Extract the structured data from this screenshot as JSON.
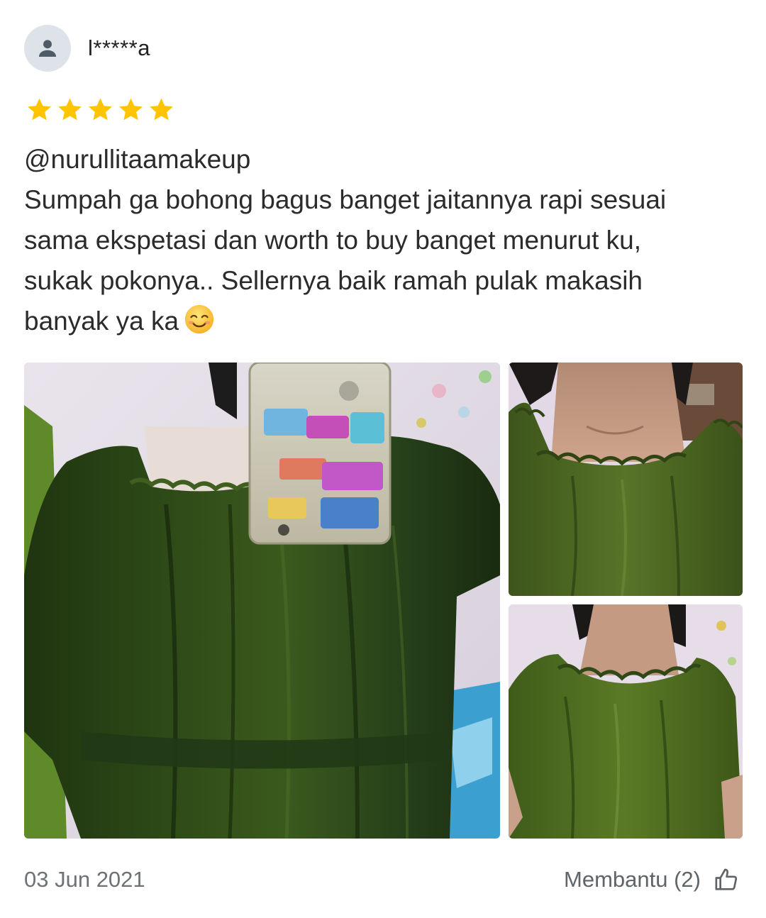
{
  "reviewer": {
    "name": "l*****a",
    "avatar_icon": "user-icon"
  },
  "rating": {
    "value": 5,
    "max": 5,
    "star_color": "#ffc400"
  },
  "review": {
    "text_line1": "@nurullitaamakeup",
    "text_line2": "Sumpah ga bohong bagus banget jaitannya rapi sesuai",
    "text_line3": "sama ekspetasi dan worth to buy banget menurut ku,",
    "text_line4": "sukak pokonya.. Sellernya baik ramah pulak makasih",
    "text_line5": "banyak ya ka",
    "emoji": "smiling-face-icon"
  },
  "photos": [
    {
      "subject": "mirror selfie wearing green satin off-shoulder top"
    },
    {
      "subject": "close-up of green ruffled neckline"
    },
    {
      "subject": "green satin top with elastic neckline"
    }
  ],
  "footer": {
    "date": "03 Jun 2021",
    "helpful_label": "Membantu (2)",
    "helpful_icon": "thumbs-up-icon"
  }
}
